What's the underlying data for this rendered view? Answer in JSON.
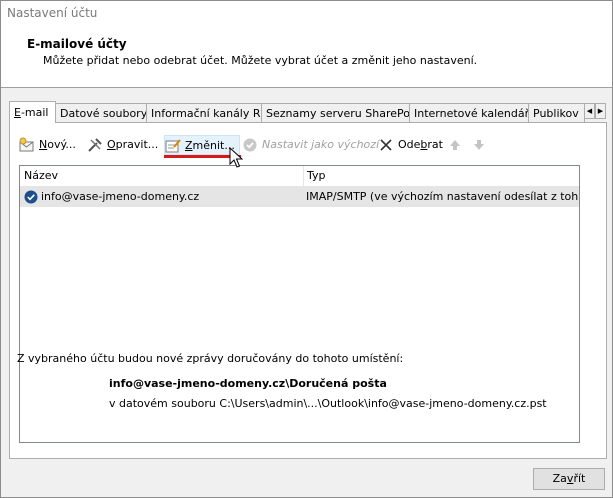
{
  "window": {
    "title": "Nastavení účtu"
  },
  "header": {
    "title": "E-mailové účty",
    "subtitle": "Můžete přidat nebo odebrat účet. Můžete vybrat účet a změnit jeho nastavení."
  },
  "tabs": [
    {
      "mn": "E",
      "rest": "-mail",
      "active": true
    },
    {
      "mn": "",
      "rest": "Datové soubory",
      "active": false
    },
    {
      "mn": "",
      "rest": "Informační kanály RSS",
      "active": false
    },
    {
      "mn": "",
      "rest": "Seznamy serveru SharePoint",
      "active": false
    },
    {
      "mn": "",
      "rest": "Internetové kalendáře",
      "active": false
    },
    {
      "mn": "",
      "rest": "Publikov",
      "active": false
    }
  ],
  "toolbar": {
    "new": {
      "mn": "N",
      "rest": "ový..."
    },
    "repair": {
      "mn": "O",
      "rest": "pravit..."
    },
    "change": {
      "mn": "Z",
      "rest": "měnit..."
    },
    "set_default": {
      "label": "Nastavit jako výchozí"
    },
    "remove": {
      "pre": "Ode",
      "mn": "b",
      "rest": "rat"
    }
  },
  "list": {
    "columns": [
      "Název",
      "Typ"
    ],
    "rows": [
      {
        "name": "info@vase-jmeno-domeny.cz",
        "type": "IMAP/SMTP (ve výchozím nastavení odesílat z tohoto ..."
      }
    ]
  },
  "delivery": {
    "label": "Z vybraného účtu budou nové zprávy doručovány do tohoto umístění:",
    "target": "info@vase-jmeno-domeny.cz\\Doručená pošta",
    "file": "v datovém souboru C:\\Users\\admin\\...\\Outlook\\info@vase-jmeno-domeny.cz.pst"
  },
  "close_button": {
    "pre": "Za",
    "mn": "v",
    "rest": "řít"
  },
  "colors": {
    "highlight_underline": "#d7191c",
    "selected_row": "#e5e5e5",
    "disabled_text": "#a0a0a0"
  },
  "icons": [
    "new-account-icon",
    "repair-icon",
    "change-icon",
    "set-default-icon",
    "remove-x-icon",
    "move-up-icon",
    "move-down-icon",
    "account-check-icon",
    "mouse-cursor-icon"
  ]
}
